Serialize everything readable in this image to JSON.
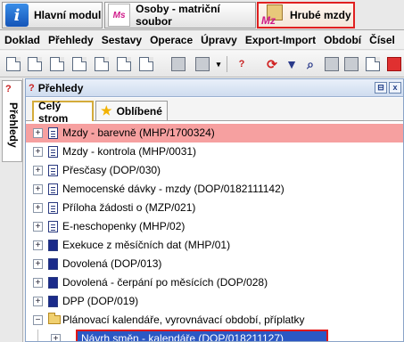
{
  "modules": {
    "hlavni": "Hlavní modul",
    "osoby": "Osoby - matriční soubor",
    "osoby_icon_text": "Ms",
    "hrube": "Hrubé mzdy",
    "hrube_icon_text": "Mz"
  },
  "menu": [
    "Doklad",
    "Přehledy",
    "Sestavy",
    "Operace",
    "Úpravy",
    "Export-Import",
    "Období",
    "Čísel"
  ],
  "side_tab": "Přehledy",
  "panel": {
    "title": "Přehledy",
    "pin": "⊟",
    "close": "x"
  },
  "tabs": {
    "all": "Celý strom",
    "fav": "Oblíbené"
  },
  "tree": [
    {
      "label": "Mzdy - barevně (MHP/1700324)",
      "icon": "list-icon",
      "highlight": true
    },
    {
      "label": "Mzdy - kontrola (MHP/0031)",
      "icon": "list-icon"
    },
    {
      "label": "Přesčasy (DOP/030)",
      "icon": "list-icon"
    },
    {
      "label": "Nemocenské dávky - mzdy (DOP/0182111142)",
      "icon": "list-icon"
    },
    {
      "label": "Příloha žádosti o (MZP/021)",
      "icon": "list-icon"
    },
    {
      "label": "E-neschopenky (MHP/02)",
      "icon": "list-icon"
    },
    {
      "label": "Exekuce z měsíčních dat (MHP/01)",
      "icon": "solid-icon"
    },
    {
      "label": "Dovolená (DOP/013)",
      "icon": "solid-icon"
    },
    {
      "label": "Dovolená - čerpání po měsících (DOP/028)",
      "icon": "solid-icon"
    },
    {
      "label": "DPP (DOP/019)",
      "icon": "solid-icon"
    },
    {
      "label": "Plánovací kalendáře, vyrovnávací období, příplatky",
      "icon": "folder-icon"
    }
  ],
  "selected_child": "Návrh směn - kalendáře (DOP/018211127)",
  "expander_plus": "+",
  "expander_minus": "−",
  "colors": {
    "highlight": "#f6a0a0",
    "selection": "#2b58c4",
    "annotation_red": "#e01818"
  }
}
